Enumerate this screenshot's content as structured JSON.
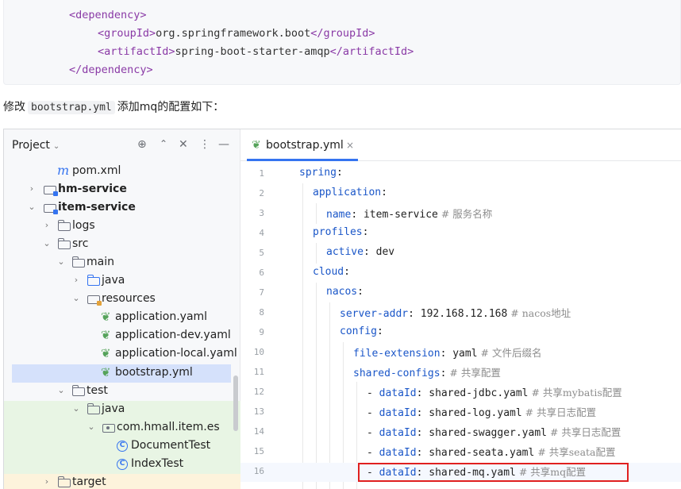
{
  "top_code": {
    "lines": [
      {
        "open": "<dependency>",
        "text": "",
        "close": ""
      },
      {
        "open": "<groupId>",
        "text": "org.springframework.boot",
        "close": "</groupId>"
      },
      {
        "open": "<artifactId>",
        "text": "spring-boot-starter-amqp",
        "close": "</artifactId>"
      },
      {
        "open": "</dependency>",
        "text": "",
        "close": ""
      }
    ]
  },
  "description": {
    "before": "修改",
    "code": "bootstrap.yml",
    "after": "添加mq的配置如下："
  },
  "project_panel": {
    "title": "Project",
    "tree": [
      {
        "label": "pom.xml",
        "icon": "m-icon",
        "arrow": ""
      },
      {
        "label": "hm-service",
        "icon": "module-folder-icon",
        "arrow": "›"
      },
      {
        "label": "item-service",
        "icon": "module-folder-icon",
        "arrow": "⌄"
      },
      {
        "label": "logs",
        "icon": "folder-icon",
        "arrow": "›"
      },
      {
        "label": "src",
        "icon": "folder-icon",
        "arrow": "⌄"
      },
      {
        "label": "main",
        "icon": "folder-icon",
        "arrow": "⌄"
      },
      {
        "label": "java",
        "icon": "source-folder-icon",
        "arrow": "›"
      },
      {
        "label": "resources",
        "icon": "resources-folder-icon",
        "arrow": "⌄"
      },
      {
        "label": "application.yaml",
        "icon": "spring-leaf-icon",
        "arrow": ""
      },
      {
        "label": "application-dev.yaml",
        "icon": "spring-leaf-icon",
        "arrow": ""
      },
      {
        "label": "application-local.yaml",
        "icon": "spring-leaf-icon",
        "arrow": ""
      },
      {
        "label": "bootstrap.yml",
        "icon": "spring-leaf-icon",
        "arrow": ""
      },
      {
        "label": "test",
        "icon": "folder-icon",
        "arrow": "⌄"
      },
      {
        "label": "java",
        "icon": "test-folder-icon",
        "arrow": "⌄"
      },
      {
        "label": "com.hmall.item.es",
        "icon": "package-icon",
        "arrow": "⌄"
      },
      {
        "label": "DocumentTest",
        "icon": "class-icon",
        "arrow": ""
      },
      {
        "label": "IndexTest",
        "icon": "class-icon",
        "arrow": ""
      },
      {
        "label": "target",
        "icon": "folder-icon",
        "arrow": "›"
      }
    ]
  },
  "editor": {
    "tab_label": "bootstrap.yml",
    "tab_close": "×",
    "line_numbers": [
      "1",
      "2",
      "3",
      "4",
      "5",
      "6",
      "7",
      "8",
      "9",
      "10",
      "11",
      "12",
      "13",
      "14",
      "15",
      "16"
    ],
    "lines": [
      {
        "key": "spring",
        "sep": ":",
        "value": "",
        "comment": ""
      },
      {
        "key": "application",
        "sep": ":",
        "value": "",
        "comment": ""
      },
      {
        "key": "name",
        "sep": ":",
        "value": " item-service",
        "comment": " # 服务名称"
      },
      {
        "key": "profiles",
        "sep": ":",
        "value": "",
        "comment": ""
      },
      {
        "key": "active",
        "sep": ":",
        "value": " dev",
        "comment": ""
      },
      {
        "key": "cloud",
        "sep": ":",
        "value": "",
        "comment": ""
      },
      {
        "key": "nacos",
        "sep": ":",
        "value": "",
        "comment": ""
      },
      {
        "key": "server-addr",
        "sep": ":",
        "value": " 192.168.12.168",
        "comment": " # nacos地址"
      },
      {
        "key": "config",
        "sep": ":",
        "value": "",
        "comment": ""
      },
      {
        "key": "file-extension",
        "sep": ":",
        "value": " yaml",
        "comment": " # 文件后缀名"
      },
      {
        "key": "shared-configs",
        "sep": ":",
        "value": "",
        "comment": " # 共享配置"
      },
      {
        "key": "dataId",
        "sep": ":",
        "value": " shared-jdbc.yaml",
        "comment": " # 共享mybatis配置"
      },
      {
        "key": "dataId",
        "sep": ":",
        "value": " shared-log.yaml",
        "comment": " # 共享日志配置"
      },
      {
        "key": "dataId",
        "sep": ":",
        "value": " shared-swagger.yaml",
        "comment": " # 共享日志配置"
      },
      {
        "key": "dataId",
        "sep": ":",
        "value": " shared-seata.yaml",
        "comment": " # 共享seata配置"
      },
      {
        "key": "dataId",
        "sep": ":",
        "value": " shared-mq.yaml",
        "comment": " # 共享mq配置"
      }
    ]
  },
  "colors": {
    "accent": "#3574f0",
    "highlight_border": "#e02020",
    "spring_leaf": "#55a35a"
  }
}
